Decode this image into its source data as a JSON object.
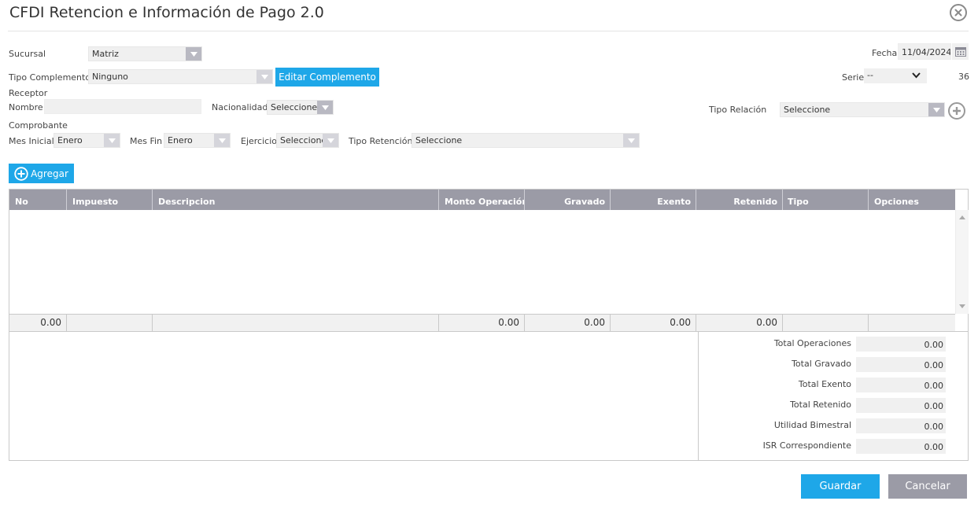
{
  "window": {
    "title": "CFDI Retencion e Información de Pago 2.0",
    "close_icon": "close-circle-icon"
  },
  "form": {
    "sucursal_label": "Sucursal",
    "sucursal_value": "Matriz",
    "fecha_label": "Fecha",
    "fecha_value": "11/04/2024",
    "calendar_icon": "calendar-icon",
    "tipo_complemento_label": "Tipo Complemento",
    "tipo_complemento_value": "Ninguno",
    "editar_complemento_label": "Editar Complemento",
    "serie_label": "Serie",
    "serie_value": "--",
    "folio_value": "36",
    "receptor_label": "Receptor",
    "nombre_label": "Nombre",
    "nombre_value": "",
    "nacionalidad_label": "Nacionalidad",
    "nacionalidad_value": "Seleccione",
    "tipo_relacion_label": "Tipo Relación",
    "tipo_relacion_value": "Seleccione",
    "comprobante_label": "Comprobante",
    "mes_inicial_label": "Mes Inicial",
    "mes_inicial_value": "Enero",
    "mes_fin_label": "Mes Fin",
    "mes_fin_value": "Enero",
    "ejercicio_label": "Ejercicio",
    "ejercicio_value": "Seleccione",
    "tipo_retencion_label": "Tipo Retención",
    "tipo_retencion_value": "Seleccione",
    "agregar_label": "Agregar"
  },
  "grid": {
    "columns": [
      "No",
      "Impuesto",
      "Descripcion",
      "Monto Operación",
      "Gravado",
      "Exento",
      "Retenido",
      "Tipo",
      "Opciones"
    ],
    "rows": [],
    "footer": [
      "0.00",
      "",
      "",
      "0.00",
      "0.00",
      "0.00",
      "0.00",
      "",
      ""
    ]
  },
  "totals": [
    {
      "label": "Total Operaciones",
      "value": "0.00"
    },
    {
      "label": "Total Gravado",
      "value": "0.00"
    },
    {
      "label": "Total Exento",
      "value": "0.00"
    },
    {
      "label": "Total Retenido",
      "value": "0.00"
    },
    {
      "label": "Utilidad Bimestral",
      "value": "0.00"
    },
    {
      "label": "ISR Correspondiente",
      "value": "0.00"
    }
  ],
  "actions": {
    "save_label": "Guardar",
    "cancel_label": "Cancelar"
  },
  "colors": {
    "accent": "#1ea7e8",
    "header_gray": "#9b9ba6"
  }
}
